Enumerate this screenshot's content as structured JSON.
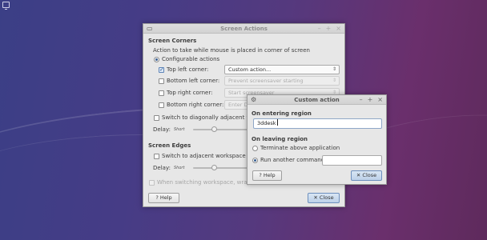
{
  "main": {
    "title": "Screen Actions",
    "corners": {
      "heading": "Screen Corners",
      "description": "Action to take while mouse is placed in corner of screen",
      "configurable_label": "Configurable actions",
      "top_left": {
        "label": "Top left corner:",
        "value": "Custom action..."
      },
      "bottom_left": {
        "label": "Bottom left corner:",
        "value": "Prevent screensaver starting"
      },
      "top_right": {
        "label": "Top right corner:",
        "value": "Start screensaver"
      },
      "bottom_right": {
        "label": "Bottom right corner:",
        "value": "Enter D"
      },
      "switch_label": "Switch to diagonally adjacent wo",
      "delay_label": "Delay:",
      "delay_short": "Short",
      "delay_level": 0.33
    },
    "edges": {
      "heading": "Screen Edges",
      "switch_label": "Switch to adjacent workspace wh",
      "delay_label": "Delay:",
      "delay_short": "Short",
      "delay_level": 0.33,
      "wrap_label": "When switching workspace, wrap a"
    },
    "help_label": "Help",
    "close_label": "Close"
  },
  "dialog": {
    "title": "Custom action",
    "entering_heading": "On entering region",
    "entering_value": "3ddesk",
    "leaving_heading": "On leaving region",
    "terminate_label": "Terminate above application",
    "run_label": "Run another command:",
    "run_value": "",
    "help_label": "Help",
    "close_label": "Close"
  },
  "icons": {
    "window_icon": "monitor-icon",
    "dialog_icon": "gear-icon",
    "minimize": "minimize-icon",
    "maximize": "maximize-icon",
    "close": "close-icon",
    "help": "help-icon",
    "close_x": "close-x-icon"
  }
}
